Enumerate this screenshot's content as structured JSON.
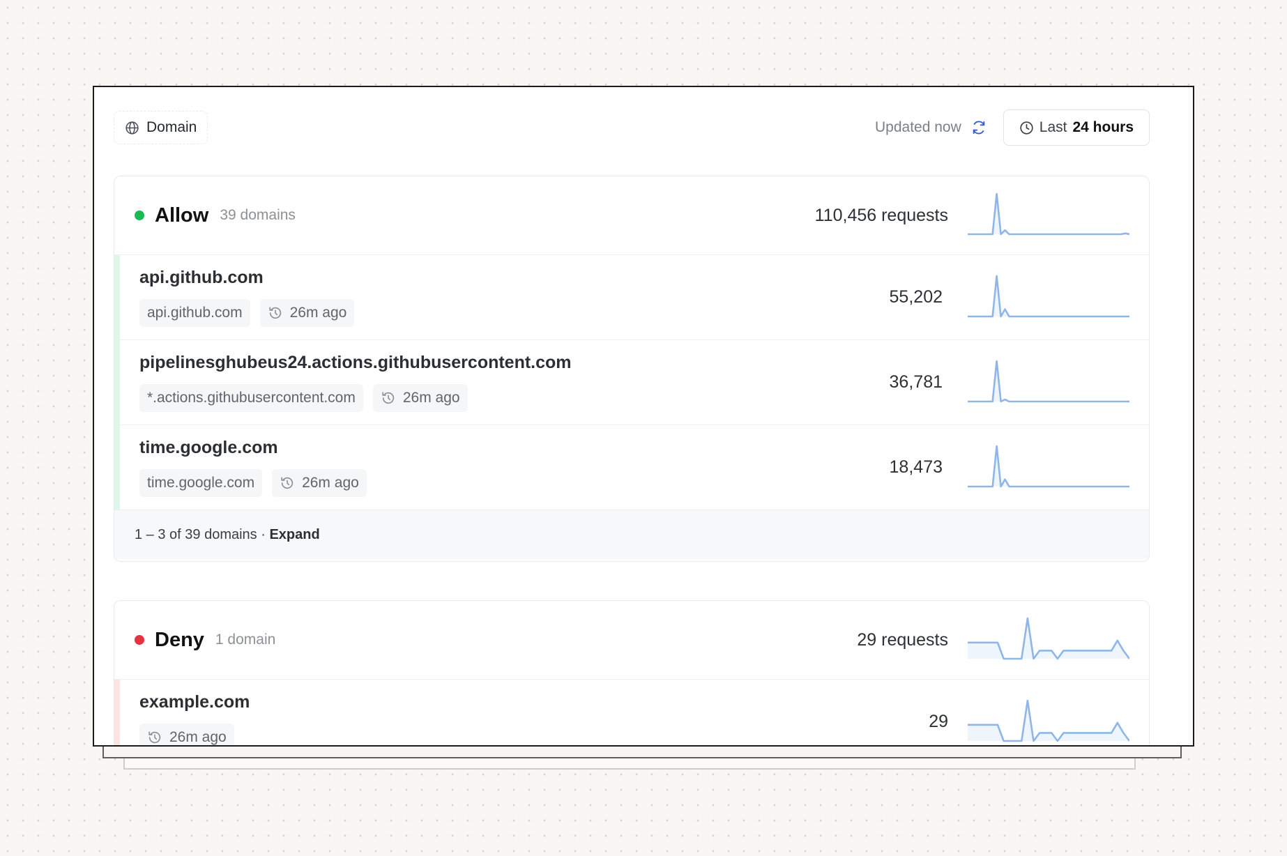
{
  "toolbar": {
    "filter_label": "Domain",
    "updated_text": "Updated now",
    "range_prefix": "Last",
    "range_value": "24 hours"
  },
  "groups": {
    "allow": {
      "name": "Allow",
      "count_text": "39 domains",
      "requests_text": "110,456 requests",
      "status_color": "#1db954",
      "sparkline": [
        0,
        0,
        0,
        0,
        0,
        0,
        0,
        1,
        0,
        0.1,
        0,
        0,
        0,
        0,
        0,
        0,
        0,
        0,
        0,
        0,
        0,
        0,
        0,
        0,
        0,
        0,
        0,
        0,
        0,
        0,
        0,
        0,
        0,
        0,
        0,
        0,
        0,
        0,
        0.02,
        0
      ],
      "rows": [
        {
          "name": "api.github.com",
          "tag": "api.github.com",
          "time": "26m ago",
          "count": "55,202",
          "sparkline": [
            0,
            0,
            0,
            0,
            0,
            0,
            0,
            1,
            0,
            0.18,
            0,
            0,
            0,
            0,
            0,
            0,
            0,
            0,
            0,
            0,
            0,
            0,
            0,
            0,
            0,
            0,
            0,
            0,
            0,
            0,
            0,
            0,
            0,
            0,
            0,
            0,
            0,
            0,
            0,
            0
          ]
        },
        {
          "name": "pipelinesghubeus24.actions.githubusercontent.com",
          "tag": "*.actions.githubusercontent.com",
          "time": "26m ago",
          "count": "36,781",
          "sparkline": [
            0,
            0,
            0,
            0,
            0,
            0,
            0,
            1,
            0,
            0.05,
            0,
            0,
            0,
            0,
            0,
            0,
            0,
            0,
            0,
            0,
            0,
            0,
            0,
            0,
            0,
            0,
            0,
            0,
            0,
            0,
            0,
            0,
            0,
            0,
            0,
            0,
            0,
            0,
            0,
            0
          ]
        },
        {
          "name": "time.google.com",
          "tag": "time.google.com",
          "time": "26m ago",
          "count": "18,473",
          "sparkline": [
            0,
            0,
            0,
            0,
            0,
            0,
            0,
            1,
            0,
            0.18,
            0,
            0,
            0,
            0,
            0,
            0,
            0,
            0,
            0,
            0,
            0,
            0,
            0,
            0,
            0,
            0,
            0,
            0,
            0,
            0,
            0,
            0,
            0,
            0,
            0,
            0,
            0,
            0,
            0,
            0
          ]
        }
      ],
      "footer_range": "1 – 3 of 39 domains",
      "footer_sep": " · ",
      "footer_expand": "Expand"
    },
    "deny": {
      "name": "Deny",
      "count_text": "1 domain",
      "requests_text": "29 requests",
      "status_color": "#e5343f",
      "sparkline": [
        0.4,
        0.4,
        0.4,
        0.4,
        0.4,
        0.4,
        0,
        0,
        0,
        0,
        1,
        0,
        0.2,
        0.2,
        0.2,
        0,
        0.2,
        0.2,
        0.2,
        0.2,
        0.2,
        0.2,
        0.2,
        0.2,
        0.2,
        0.45,
        0.2,
        0
      ],
      "rows": [
        {
          "name": "example.com",
          "tag": "",
          "time": "26m ago",
          "count": "29",
          "sparkline": [
            0.4,
            0.4,
            0.4,
            0.4,
            0.4,
            0.4,
            0,
            0,
            0,
            0,
            1,
            0,
            0.2,
            0.2,
            0.2,
            0,
            0.2,
            0.2,
            0.2,
            0.2,
            0.2,
            0.2,
            0.2,
            0.2,
            0.2,
            0.45,
            0.2,
            0
          ]
        }
      ]
    }
  },
  "colors": {
    "allow_accent": "#dff7e8",
    "deny_accent": "#fde4e2",
    "sparkline_stroke": "#8fb6e6",
    "sparkline_fill": "#eaf2fc"
  }
}
